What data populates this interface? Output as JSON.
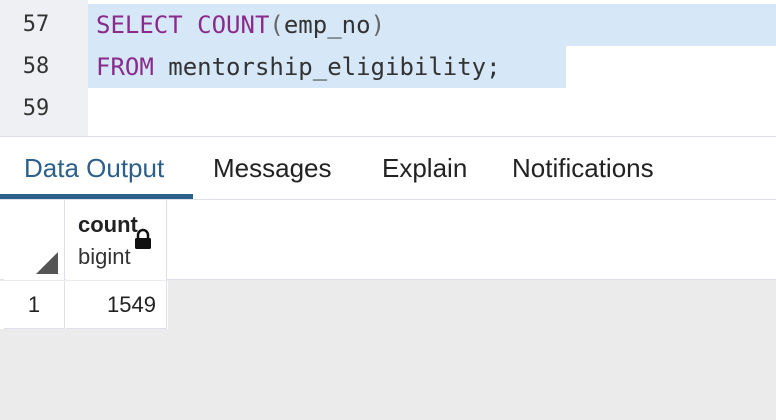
{
  "editor": {
    "lines": [
      {
        "number": "57",
        "tokens": [
          "SELECT",
          "COUNT",
          "(",
          "emp_no",
          ")"
        ]
      },
      {
        "number": "58",
        "tokens": [
          "FROM",
          "mentorship_eligibility;"
        ]
      },
      {
        "number": "59",
        "tokens": []
      }
    ]
  },
  "tabs": [
    {
      "label": "Data Output",
      "active": true
    },
    {
      "label": "Messages",
      "active": false
    },
    {
      "label": "Explain",
      "active": false
    },
    {
      "label": "Notifications",
      "active": false
    }
  ],
  "grid": {
    "columns": [
      {
        "name": "count",
        "type": "bigint",
        "icon": "lock-icon"
      }
    ],
    "rows": [
      {
        "row_number": "1",
        "values": [
          "1549"
        ]
      }
    ]
  },
  "colors": {
    "keyword": "#8a2a8a",
    "selection": "#d6e8f7",
    "active_tab": "#2c5f8a"
  }
}
